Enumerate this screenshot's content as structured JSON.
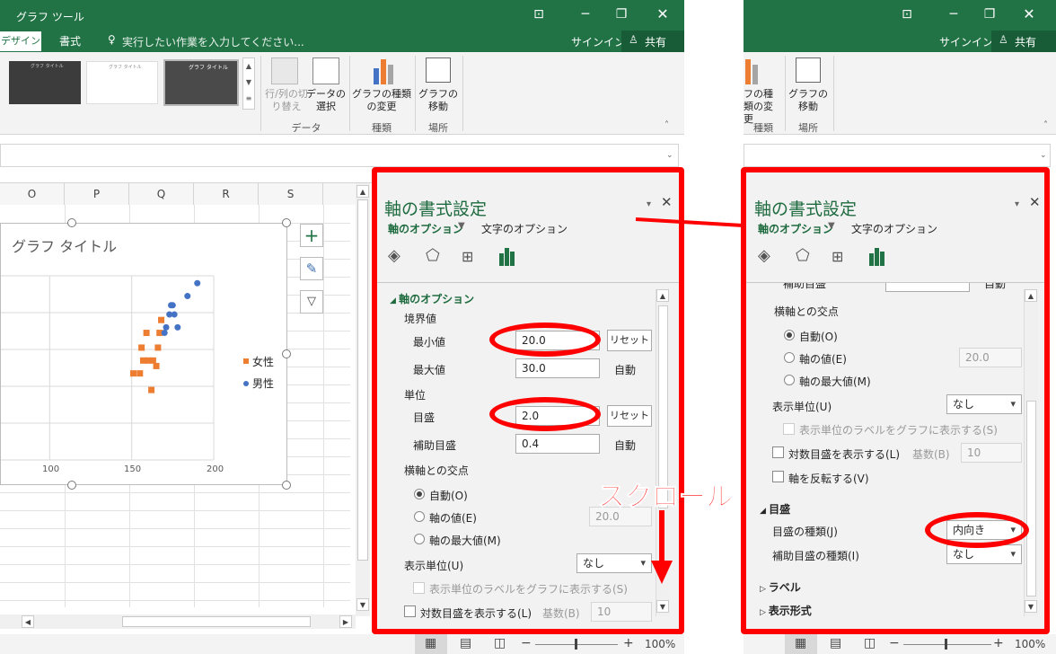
{
  "left_window": {
    "title_bar": {
      "context": "グラフ ツール"
    },
    "tabs": [
      "デザイン",
      "書式"
    ],
    "tell_me": "実行したい作業を入力してください...",
    "signin": "サインイン",
    "share": "共有",
    "ribbon": {
      "style_thumbs": [
        "グラフ タイトル",
        "グラフ タイトル",
        "グラフ タイトル"
      ],
      "switch_row_col": "行/列の切り替え",
      "select_data": "データの選択",
      "change_chart_type": "グラフの種類の変更",
      "move_chart": "グラフの移動",
      "groups": {
        "data": "データ",
        "type": "種類",
        "location": "場所"
      }
    },
    "columns": [
      "O",
      "P",
      "Q",
      "R",
      "S"
    ],
    "chart": {
      "title": "グラフ タイトル",
      "x_ticks": [
        "100",
        "150",
        "200"
      ],
      "legend": [
        "女性",
        "男性"
      ]
    },
    "zoom": "100%"
  },
  "chart_data": {
    "type": "scatter",
    "title": "グラフ タイトル",
    "xlim": [
      50,
      200
    ],
    "ylim": [
      20.0,
      30.0
    ],
    "series": [
      {
        "name": "女性",
        "color": "#ed7d31",
        "points": [
          [
            151,
            24.7
          ],
          [
            155,
            24.7
          ],
          [
            160,
            25.4
          ],
          [
            163,
            25.4
          ],
          [
            157,
            25.4
          ],
          [
            165,
            25.1
          ],
          [
            156,
            26.1
          ],
          [
            159,
            26.9
          ],
          [
            166,
            26.1
          ],
          [
            167,
            26.9
          ],
          [
            168,
            27.6
          ],
          [
            162,
            23.8
          ]
        ]
      },
      {
        "name": "男性",
        "color": "#4472c4",
        "points": [
          [
            170,
            26.9
          ],
          [
            171,
            27.2
          ],
          [
            173,
            27.9
          ],
          [
            174,
            28.4
          ],
          [
            176,
            27.9
          ],
          [
            178,
            27.2
          ],
          [
            175,
            28.4
          ],
          [
            184,
            28.9
          ],
          [
            190,
            29.6
          ]
        ]
      }
    ]
  },
  "format_panel": {
    "title": "軸の書式設定",
    "tab_axis": "軸のオプション",
    "tab_text": "文字のオプション",
    "section": "軸のオプション",
    "bounds": "境界値",
    "min_label": "最小値",
    "min_value": "20.0",
    "max_label": "最大値",
    "max_value": "30.0",
    "auto": "自動",
    "reset": "リセット",
    "units": "単位",
    "major_label": "目盛",
    "major_value": "2.0",
    "minor_label": "補助目盛",
    "minor_value": "0.4",
    "cross": "横軸との交点",
    "cross_auto": "自動(O)",
    "cross_value": "軸の値(E)",
    "cross_value_input": "20.0",
    "cross_max": "軸の最大値(M)",
    "display_units": "表示単位(U)",
    "display_units_value": "なし",
    "show_units_label": "表示単位のラベルをグラフに表示する(S)",
    "log_scale": "対数目盛を表示する(L)",
    "base_label": "基数(B)",
    "base_value": "10"
  },
  "right_panel": {
    "title": "軸の書式設定",
    "tab_axis": "軸のオプション",
    "tab_text": "文字のオプション",
    "cut_top_left": "補助目盛",
    "cut_top_right": "自動",
    "cross": "横軸との交点",
    "cross_auto": "自動(O)",
    "cross_value": "軸の値(E)",
    "cross_value_input": "20.0",
    "cross_max": "軸の最大値(M)",
    "display_units": "表示単位(U)",
    "display_units_value": "なし",
    "show_units_label": "表示単位のラベルをグラフに表示する(S)",
    "log_scale": "対数目盛を表示する(L)",
    "base_label": "基数(B)",
    "base_value": "10",
    "reverse": "軸を反転する(V)",
    "tickmarks": "目盛",
    "major_type": "目盛の種類(J)",
    "major_type_value": "内向き",
    "minor_type": "補助目盛の種類(I)",
    "minor_type_value": "なし",
    "labels": "ラベル",
    "number": "表示形式"
  },
  "right_window": {
    "signin": "サインイン",
    "share": "共有",
    "change_chart_type": "フの種類の変更",
    "move_chart": "グラフの移動",
    "groups": {
      "type": "種類",
      "location": "場所"
    },
    "zoom": "100%"
  },
  "annotation": {
    "scroll": "スクロール"
  }
}
